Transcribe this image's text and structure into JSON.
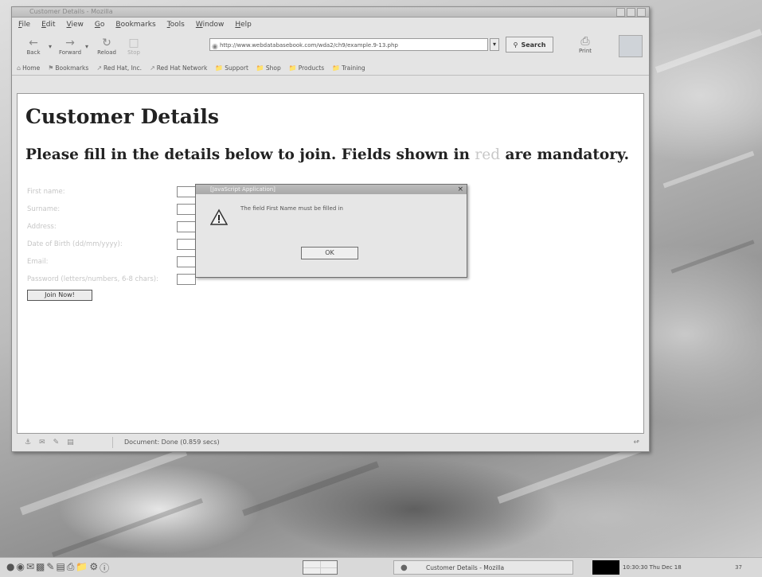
{
  "window": {
    "title": "Customer Details - Mozilla",
    "menu": [
      "File",
      "Edit",
      "View",
      "Go",
      "Bookmarks",
      "Tools",
      "Window",
      "Help"
    ]
  },
  "nav": {
    "back": "Back",
    "forward": "Forward",
    "reload": "Reload",
    "stop": "Stop",
    "url": "http://www.webdatabasebook.com/wda2/ch9/example.9-13.php",
    "search": "Search",
    "print": "Print"
  },
  "personal_toolbar": [
    "Home",
    "Bookmarks",
    "Red Hat, Inc.",
    "Red Hat Network",
    "Support",
    "Shop",
    "Products",
    "Training"
  ],
  "page": {
    "heading": "Customer Details",
    "subheading_pre": "Please fill in the details below to join. Fields shown in ",
    "subheading_red": "red",
    "subheading_post": " are mandatory.",
    "fields": [
      "First name:",
      "Surname:",
      "Address:",
      "Date of Birth (dd/mm/yyyy):",
      "Email:",
      "Password (letters/numbers, 6-8 chars):"
    ],
    "join_button": "Join Now!"
  },
  "dialog": {
    "title": "[JavaScript Application]",
    "message": "The field First Name must be filled in",
    "ok": "OK"
  },
  "status": {
    "text": "Document: Done (0.859 secs)"
  },
  "taskbar": {
    "task_label": "Customer Details - Mozilla",
    "clock": "10:30:30 Thu Dec 18",
    "tray": "37"
  }
}
